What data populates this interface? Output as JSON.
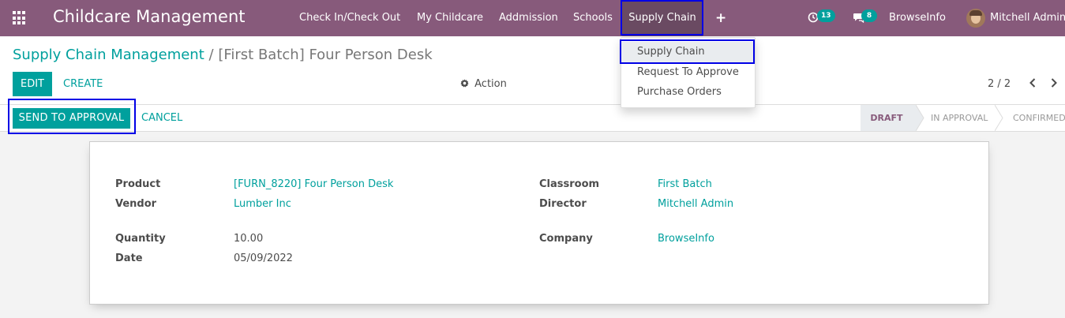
{
  "navbar": {
    "app_title": "Childcare Management",
    "menus": [
      "Check In/Check Out",
      "My Childcare",
      "Addmission",
      "Schools",
      "Supply Chain"
    ],
    "activity_count": "13",
    "message_count": "8",
    "company": "BrowseInfo",
    "user": "Mitchell Admin",
    "plus_glyph": "+",
    "accent_color": "#875a7b"
  },
  "dropdown": {
    "items": [
      "Supply Chain",
      "Request To Approve",
      "Purchase Orders"
    ]
  },
  "breadcrumb": {
    "parent": "Supply Chain Management",
    "separator": "/",
    "current": "[First Batch] Four Person Desk"
  },
  "control": {
    "edit_label": "EDIT",
    "create_label": "CREATE",
    "action_label": "Action",
    "pager": "2 / 2"
  },
  "statusbar": {
    "send_label": "SEND TO APPROVAL",
    "cancel_label": "CANCEL",
    "stages": [
      "DRAFT",
      "IN APPROVAL",
      "CONFIRMED"
    ],
    "current_stage": "DRAFT"
  },
  "form": {
    "product_label": "Product",
    "product_value": "[FURN_8220] Four Person Desk",
    "vendor_label": "Vendor",
    "vendor_value": "Lumber Inc",
    "quantity_label": "Quantity",
    "quantity_value": "10.00",
    "date_label": "Date",
    "date_value": "05/09/2022",
    "classroom_label": "Classroom",
    "classroom_value": "First Batch",
    "director_label": "Director",
    "director_value": "Mitchell Admin",
    "company_label": "Company",
    "company_value": "BrowseInfo"
  },
  "icons": {
    "apps": "apps-grid-icon",
    "activity": "clock-icon",
    "messages": "chat-icon",
    "action": "gear-icon",
    "prev": "chevron-left-icon",
    "next": "chevron-right-icon"
  },
  "colors": {
    "primary": "#00a09d",
    "navbar": "#875a7b",
    "highlight": "#0000e6"
  }
}
